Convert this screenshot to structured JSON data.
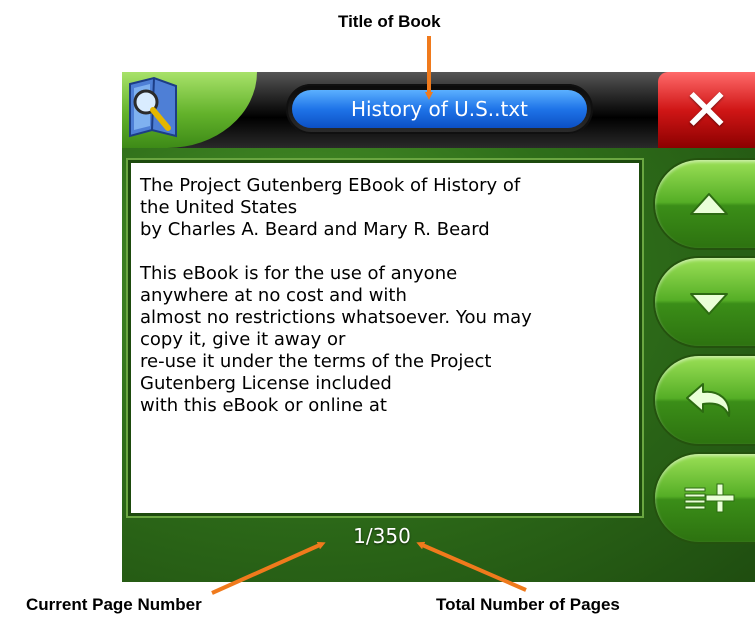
{
  "annotations": {
    "title": "Title of Book",
    "current_page": "Current Page Number",
    "total_pages": "Total Number of Pages",
    "arrow_color": "#f07a1c"
  },
  "app": {
    "app_icon": "search-book-icon",
    "book_title": "History of U.S..txt",
    "close_icon": "close-icon",
    "colors": {
      "green": "#55ae26",
      "title_blue": "#1f74e8",
      "close_red": "#d01616"
    }
  },
  "book": {
    "paragraphs": [
      [
        "The Project Gutenberg EBook of History of",
        "the United States",
        "by Charles A. Beard and Mary R. Beard"
      ],
      [
        "This eBook is for the use of anyone",
        "anywhere at no cost and with",
        "almost no restrictions whatsoever.  You may",
        "copy it, give it away or",
        "re-use it under the terms of the Project",
        "Gutenberg License included",
        "with this eBook or online at"
      ]
    ]
  },
  "sidebar": {
    "buttons": [
      {
        "icon": "scroll-up-icon"
      },
      {
        "icon": "scroll-down-icon"
      },
      {
        "icon": "back-icon"
      },
      {
        "icon": "list-add-icon"
      }
    ]
  },
  "pagination": {
    "current": "1",
    "separator": "/",
    "total": "350"
  }
}
